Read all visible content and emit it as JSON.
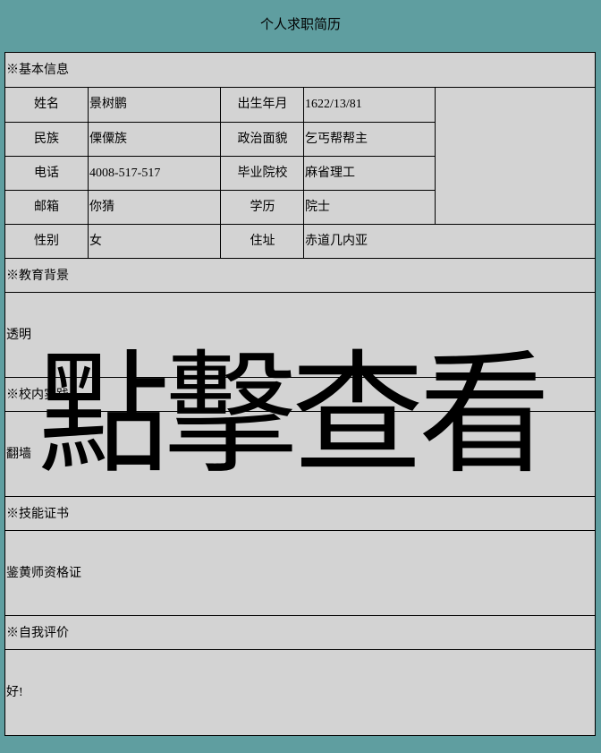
{
  "page": {
    "title": "个人求职简历"
  },
  "basic_info": {
    "heading": "※基本信息",
    "rows": [
      {
        "label1": "姓名",
        "value1": "景树鹏",
        "label2": "出生年月",
        "value2": "1622/13/81"
      },
      {
        "label1": "民族",
        "value1": "傈僳族",
        "label2": "政治面貌",
        "value2": "乞丐帮帮主"
      },
      {
        "label1": "电话",
        "value1": "4008-517-517",
        "label2": "毕业院校",
        "value2": "麻省理工"
      },
      {
        "label1": "邮箱",
        "value1": "你猜",
        "label2": "学历",
        "value2": "院士"
      },
      {
        "label1": "性别",
        "value1": "女",
        "label2": "住址",
        "value2": "赤道几内亚"
      }
    ]
  },
  "education": {
    "heading": "※教育背景",
    "content": "透明"
  },
  "campus": {
    "heading": "※校内实践",
    "content": "翻墙"
  },
  "skills": {
    "heading": "※技能证书",
    "content": "鉴黄师资格证"
  },
  "self_eval": {
    "heading": "※自我评价",
    "content": "好!"
  },
  "overlay": {
    "text": "點擊查看"
  }
}
